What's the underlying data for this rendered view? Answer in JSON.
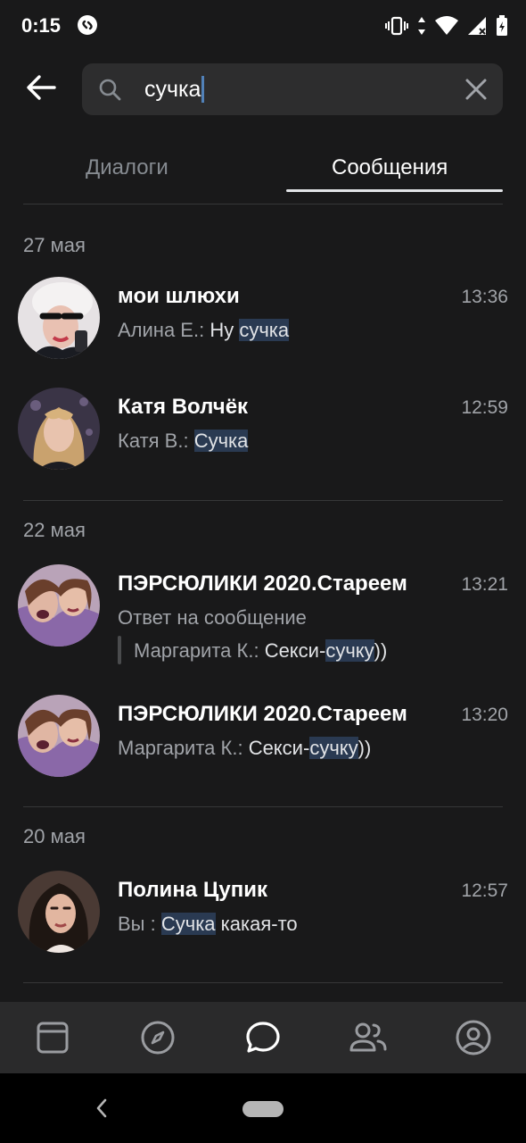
{
  "status_bar": {
    "time": "0:15",
    "icons": [
      "shazam-icon",
      "vibrate-icon",
      "data-arrows-icon",
      "wifi-icon",
      "signal-icon",
      "battery-icon"
    ]
  },
  "search": {
    "query": "сучка",
    "back_icon": "arrow-left-icon",
    "search_icon": "search-icon",
    "clear_icon": "close-icon"
  },
  "tabs": [
    {
      "label": "Диалоги",
      "active": false
    },
    {
      "label": "Сообщения",
      "active": true
    }
  ],
  "sections": [
    {
      "date": "27 мая",
      "messages": [
        {
          "title": "мои шлюхи",
          "time": "13:36",
          "sender": "Алина Е.:",
          "pre": "Ну ",
          "match": "сучка",
          "post": ""
        },
        {
          "title": "Катя Волчёк",
          "time": "12:59",
          "sender": "Катя В.:",
          "pre": "",
          "match": "Сучка",
          "post": ""
        }
      ]
    },
    {
      "date": "22 мая",
      "messages": [
        {
          "title": "ПЭРСЮЛИКИ 2020.Стареем",
          "time": "13:21",
          "reply_label": "Ответ на сообщение",
          "sender": "Маргарита К.:",
          "pre": "Секси-",
          "match": "сучку",
          "post": "))"
        },
        {
          "title": "ПЭРСЮЛИКИ 2020.Стареем",
          "time": "13:20",
          "sender": "Маргарита К.:",
          "pre": "Секси-",
          "match": "сучку",
          "post": "))"
        }
      ]
    },
    {
      "date": "20 мая",
      "messages": [
        {
          "title": "Полина Цупик",
          "time": "12:57",
          "sender": "Вы :",
          "pre": "",
          "match": "Сучка",
          "post": " какая-то"
        }
      ]
    }
  ],
  "bottom_nav": [
    "newsfeed-icon",
    "discover-icon",
    "messages-icon",
    "friends-icon",
    "profile-icon"
  ],
  "colors": {
    "background": "#19191a",
    "highlight": "#2a3a52",
    "accent": "#5181b8",
    "nav_background": "#2a2a2b"
  }
}
